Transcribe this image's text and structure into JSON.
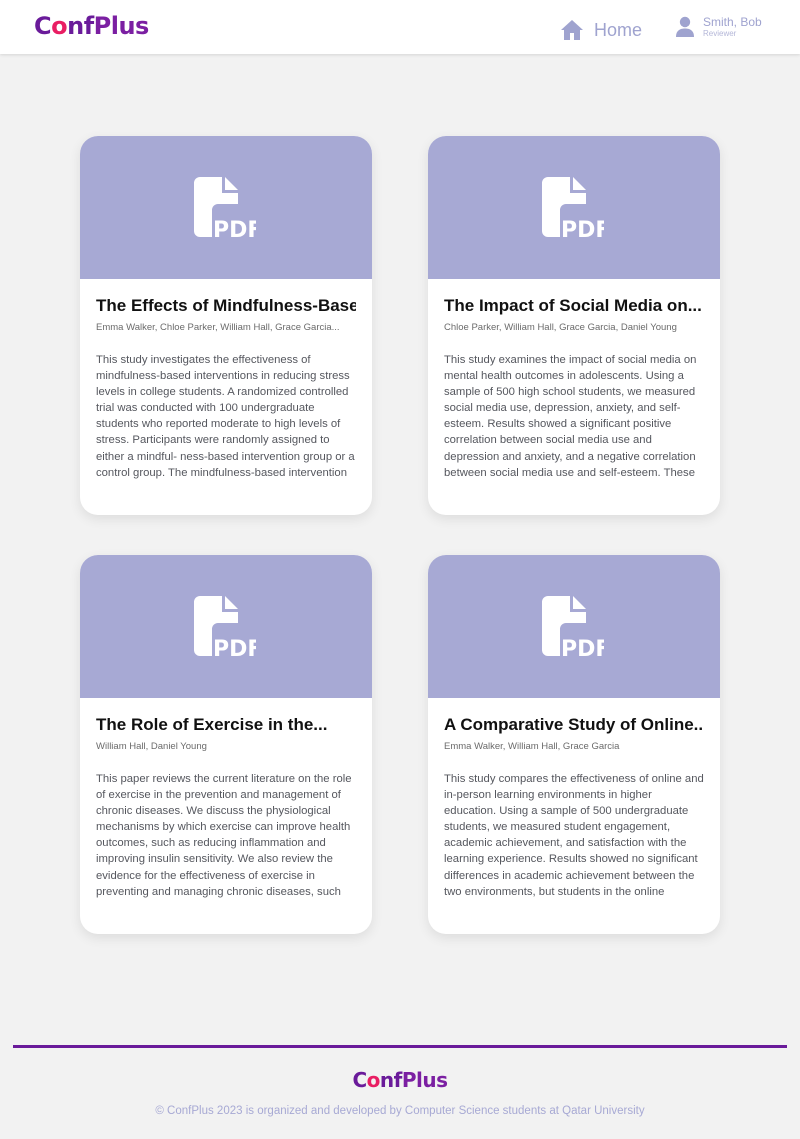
{
  "header": {
    "logo": {
      "part1": "C",
      "part2": "o",
      "part3": "nf",
      "part4": "Plus"
    },
    "nav": {
      "home_label": "Home",
      "home_icon": "home-icon"
    },
    "user": {
      "name": "Smith, Bob",
      "role": "Reviewer",
      "icon": "user-icon"
    }
  },
  "papers": [
    {
      "title": "The Effects of Mindfulness-Based",
      "authors": "Emma Walker, Chloe Parker, William Hall, Grace Garcia...",
      "abstract": "This study investigates the effectiveness of mindfulness-based interventions in reducing stress levels in college students. A randomized controlled trial was conducted with 100 undergraduate students who reported moderate to high levels of stress. Participants were randomly assigned to either a mindful- ness-based intervention group or a control group. The mindfulness-based intervention group received..."
    },
    {
      "title": "The Impact of Social Media on...",
      "authors": "Chloe Parker, William Hall, Grace Garcia, Daniel Young",
      "abstract": "This study examines the impact of social media on mental health outcomes in adolescents. Using a sample of 500 high school students, we measured social media use, depression, anxiety, and self-esteem. Results showed a significant positive correlation between social media use and depression and anxiety, and a negative correlation between social media use and self-esteem. These findings suggest that social..."
    },
    {
      "title": "The Role of Exercise in the...",
      "authors": "William Hall, Daniel Young",
      "abstract": "This paper reviews the current literature on the role of exercise in the prevention and management of chronic diseases. We discuss the physiological mechanisms by which exercise can improve health outcomes, such as reducing inflammation and improving insulin sensitivity. We also review the evidence for the effectiveness of exercise in preventing and managing chronic diseases, such as..."
    },
    {
      "title": "A Comparative Study of Online...",
      "authors": "Emma Walker, William Hall, Grace Garcia",
      "abstract": "This study compares the effectiveness of online and in-person learning environments in higher education. Using a sample of 500 undergraduate students, we measured student engagement, academic achievement, and satisfaction with the learning experience. Results showed no significant differences in academic achievement between the two environments, but students in the online environment reported higher levels..."
    }
  ],
  "pdf_icon": "pdf-file-icon",
  "footer": {
    "logo": {
      "part1": "C",
      "part2": "o",
      "part3": "nf",
      "part4": "Plus"
    },
    "copyright": "© ConfPlus 2023 is organized and developed by Computer Science students at Qatar University"
  },
  "colors": {
    "brand_purple": "#6a1b9a",
    "brand_pink": "#e91e63",
    "accent_lavender": "#a7a9d4",
    "background": "#f2f2f2"
  }
}
